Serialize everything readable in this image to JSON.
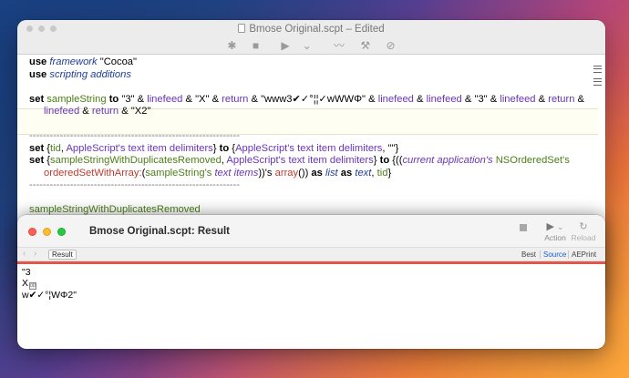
{
  "editor": {
    "title": "Bmose Original.scpt – Edited",
    "toolbar": {
      "bug_icon": "✱",
      "stop_icon": "■",
      "run_icon": "▶",
      "run_menu_icon": "⌄",
      "event_log_icon": "〰",
      "compile_icon": "⚒",
      "bundle_icon": "⊘"
    },
    "code": {
      "l1_kw": "use",
      "l1_term": "framework",
      "l1_str": " \"Cocoa\"",
      "l2_kw": "use",
      "l2_term": "scripting additions",
      "l3_set": "set",
      "l3_var": "sampleString",
      "l3_to": "to",
      "l3_a": " \"3\" & ",
      "l3_lf1": "linefeed",
      "l3_b": " & \"X\" & ",
      "l3_ret1": "return",
      "l3_c": " & \"www3✔✓°¦¦✓wWWΦ\" & ",
      "l3_lf2": "linefeed",
      "l3_d": " & ",
      "l3_lf3": "linefeed",
      "l3_e": " & \"3\" & ",
      "l3_lf4": "linefeed",
      "l3_f": " & ",
      "l3_ret2": "return",
      "l3_g": " &",
      "l4_lf": "linefeed",
      "l4_a": " & ",
      "l4_ret": "return",
      "l4_b": " & \"X2\"",
      "sep1": "--------------------------------------------------------------",
      "l5_set": "set",
      "l5_a": " {",
      "l5_tid": "tid",
      "l5_b": ", ",
      "l5_as1": "AppleScript's text item delimiters",
      "l5_c": "} ",
      "l5_to": "to",
      "l5_d": " {",
      "l5_as2": "AppleScript's text item delimiters",
      "l5_e": ", \"\"}",
      "l6_set": "set",
      "l6_a": " {",
      "l6_var": "sampleStringWithDuplicatesRemoved",
      "l6_b": ", ",
      "l6_as": "AppleScript's text item delimiters",
      "l6_c": "} ",
      "l6_to": "to",
      "l6_d": " {((",
      "l6_ca": "current application's",
      "l6_e": " ",
      "l6_nos": "NSOrderedSet's",
      "l7_owa": "orderedSetWithArray:",
      "l7_a": "(",
      "l7_ss": "sampleString's",
      "l7_b": " ",
      "l7_ti": "text items",
      "l7_c": "))'s ",
      "l7_arr": "array",
      "l7_d": "()) ",
      "l7_as": "as",
      "l7_e": " ",
      "l7_list": "list",
      "l7_f": " ",
      "l7_as2": "as",
      "l7_g": " ",
      "l7_text": "text",
      "l7_h": ", ",
      "l7_tid": "tid",
      "l7_i": "}",
      "sep2": "--------------------------------------------------------------",
      "l8_var": "sampleStringWithDuplicatesRemoved"
    }
  },
  "result_window": {
    "title": "Bmose Original.scpt: Result",
    "stop_icon": "■",
    "run_icon": "▶",
    "run_menu_icon": "⌄",
    "action_label": "Action",
    "reload_icon": "↻",
    "reload_label": "Reload",
    "back_icon": "‹",
    "forward_icon": "›",
    "result_tab": "Result",
    "format_tabs": [
      "Best",
      "Source",
      "AEPrint"
    ],
    "active_format": "Source",
    "output_line1": "\"3",
    "output_line2": "X",
    "output_ctrl": "0D",
    "output_line3": "w✔✓°¦WΦ2\""
  }
}
